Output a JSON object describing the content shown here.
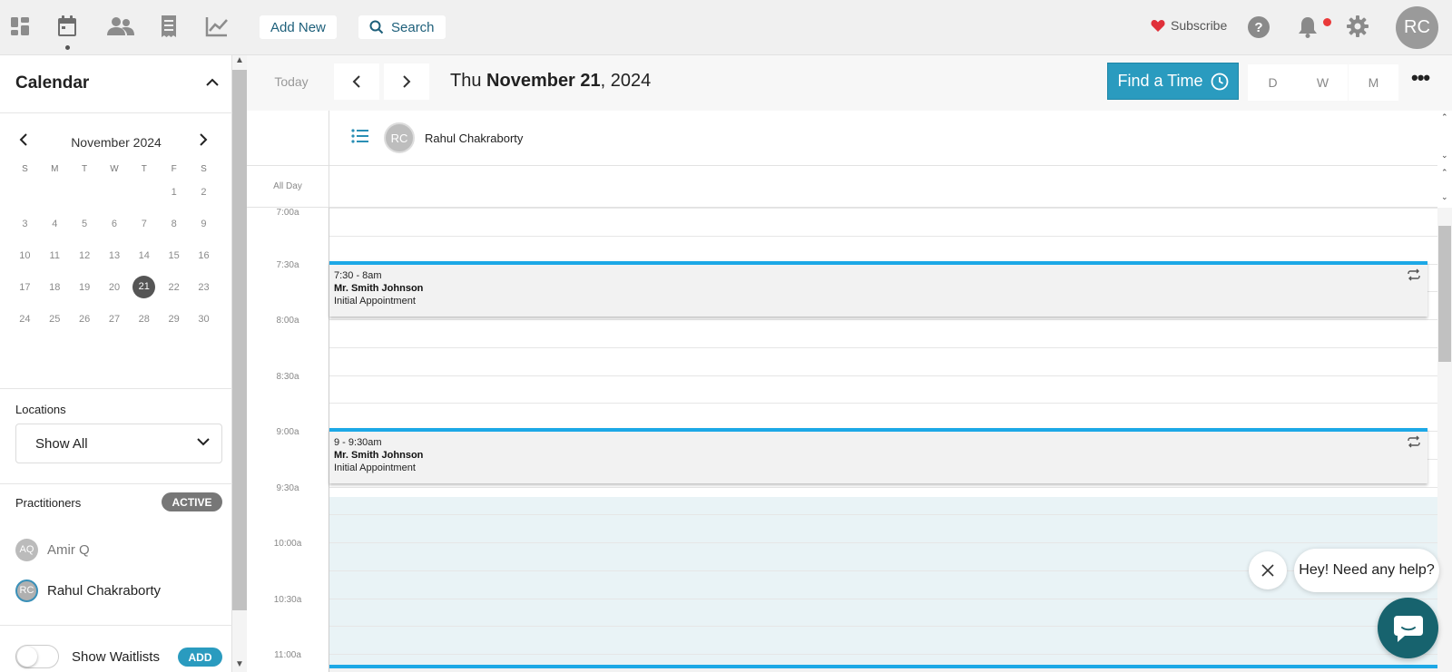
{
  "topbar": {
    "nav_icons": [
      "dashboard-icon",
      "calendar-icon",
      "people-icon",
      "receipt-icon",
      "chart-icon"
    ],
    "add_new_label": "Add New",
    "search_label": "Search",
    "subscribe_label": "Subscribe",
    "help_label": "?",
    "avatar_initials": "RC",
    "colors": {
      "heart": "#e0303a",
      "notification_dot": "#ea3a3a",
      "link": "#1d5f7a"
    }
  },
  "sidebar": {
    "title": "Calendar",
    "mini_calendar": {
      "month_label": "November 2024",
      "weekdays": [
        "S",
        "M",
        "T",
        "W",
        "T",
        "F",
        "S"
      ],
      "weeks": [
        [
          "",
          "",
          "",
          "",
          "",
          "1",
          "2"
        ],
        [
          "3",
          "4",
          "5",
          "6",
          "7",
          "8",
          "9"
        ],
        [
          "10",
          "11",
          "12",
          "13",
          "14",
          "15",
          "16"
        ],
        [
          "17",
          "18",
          "19",
          "20",
          "21",
          "22",
          "23"
        ],
        [
          "24",
          "25",
          "26",
          "27",
          "28",
          "29",
          "30"
        ]
      ],
      "selected_day": "21"
    },
    "locations": {
      "label": "Locations",
      "selected": "Show All"
    },
    "practitioners": {
      "label": "Practitioners",
      "badge": "ACTIVE",
      "items": [
        {
          "initials": "AQ",
          "name": "Amir Q"
        },
        {
          "initials": "RC",
          "name": "Rahul Chakraborty"
        }
      ]
    },
    "waitlist": {
      "label": "Show Waitlists",
      "add_label": "ADD",
      "enabled": false
    }
  },
  "toolbar": {
    "today_label": "Today",
    "date_prefix": "Thu ",
    "date_bold": "November 21",
    "date_suffix": ", 2024",
    "find_time_label": "Find a Time",
    "views": [
      "D",
      "W",
      "M"
    ],
    "more_label": "•••",
    "colors": {
      "find_time_bg": "#2a9bbf"
    }
  },
  "calendar": {
    "resource": {
      "initials": "RC",
      "name": "Rahul Chakraborty"
    },
    "all_day_label": "All Day",
    "time_labels": [
      "7:00a",
      "7:30a",
      "8:00a",
      "8:30a",
      "9:00a",
      "9:30a",
      "10:00a",
      "10:30a",
      "11:00a"
    ],
    "events": [
      {
        "time": "7:30 - 8am",
        "client": "Mr. Smith Johnson",
        "type": "Initial Appointment"
      },
      {
        "time": "9 - 9:30am",
        "client": "Mr. Smith Johnson",
        "type": "Initial Appointment"
      }
    ],
    "colors": {
      "event_accent": "#1ca8e6",
      "available_shade": "#e9f3f6"
    }
  },
  "chat": {
    "bubble_text": "Hey! Need any help?",
    "colors": {
      "launcher": "#17636e"
    }
  }
}
